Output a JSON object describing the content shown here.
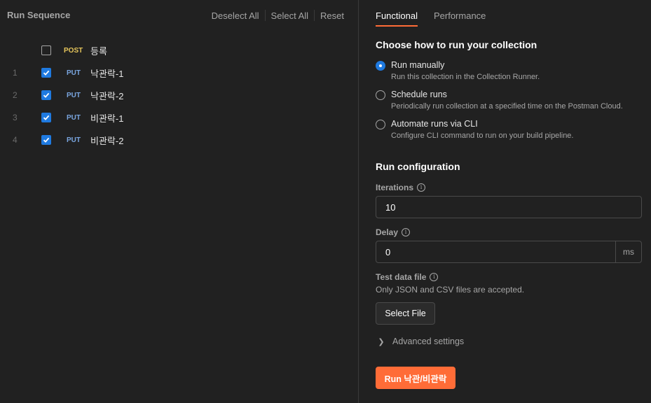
{
  "run_sequence": {
    "title": "Run Sequence",
    "actions": {
      "deselect_all": "Deselect All",
      "select_all": "Select All",
      "reset": "Reset"
    },
    "header_row": {
      "method": "POST",
      "name": "등록",
      "checked": false
    },
    "rows": [
      {
        "index": "1",
        "method": "PUT",
        "name": "낙관락-1",
        "checked": true
      },
      {
        "index": "2",
        "method": "PUT",
        "name": "낙관락-2",
        "checked": true
      },
      {
        "index": "3",
        "method": "PUT",
        "name": "비관락-1",
        "checked": true
      },
      {
        "index": "4",
        "method": "PUT",
        "name": "비관락-2",
        "checked": true
      }
    ]
  },
  "tabs": {
    "functional": "Functional",
    "performance": "Performance",
    "active": "functional"
  },
  "run_mode": {
    "title": "Choose how to run your collection",
    "options": [
      {
        "label": "Run manually",
        "description": "Run this collection in the Collection Runner.",
        "selected": true
      },
      {
        "label": "Schedule runs",
        "description": "Periodically run collection at a specified time on the Postman Cloud.",
        "selected": false
      },
      {
        "label": "Automate runs via CLI",
        "description": "Configure CLI command to run on your build pipeline.",
        "selected": false
      }
    ]
  },
  "run_config": {
    "title": "Run configuration",
    "iterations_label": "Iterations",
    "iterations_value": "10",
    "delay_label": "Delay",
    "delay_value": "0",
    "delay_unit": "ms",
    "test_data_label": "Test data file",
    "test_data_helper": "Only JSON and CSV files are accepted.",
    "select_file_label": "Select File",
    "advanced_label": "Advanced settings",
    "run_button_label": "Run 낙관/비관락"
  },
  "colors": {
    "accent": "#ff6c37",
    "checkbox": "#1f7ae0",
    "post": "#e5c55b",
    "put": "#7aa6e0"
  },
  "icons": {
    "info": "info-icon",
    "chevron": "chevron-right-icon",
    "check": "check-icon"
  }
}
